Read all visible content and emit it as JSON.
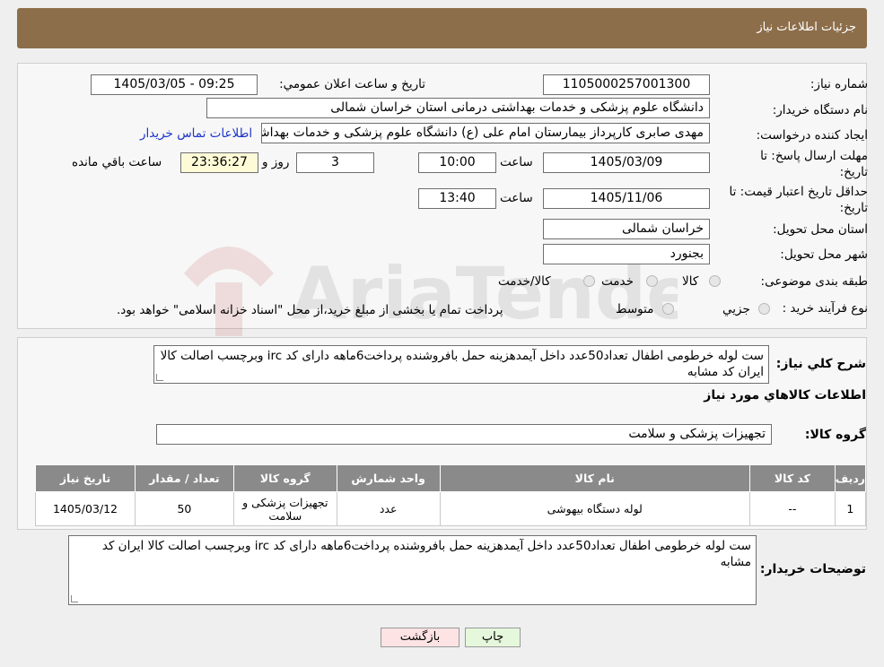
{
  "header": {
    "title": "جزئیات اطلاعات نیاز"
  },
  "watermark": {
    "text": "AriaTender.neT"
  },
  "form": {
    "need_number_label": "شماره نیاز:",
    "need_number": "1105000257001300",
    "announce_label": "تاریخ و ساعت اعلان عمومي:",
    "announce_value": "1405/03/05 - 09:25",
    "buyer_org_label": "نام دستگاه خريدار:",
    "buyer_org": "دانشگاه علوم پزشکی و خدمات بهداشتی درمانی استان خراسان شمالی",
    "creator_label": "ايجاد کننده درخواست:",
    "creator": "مهدی صابری کارپرداز بیمارستان امام علی (ع) دانشگاه علوم پزشکی و خدمات بهداشتی",
    "contact_link": "اطلاعات تماس خريدار",
    "deadline_label_1": "مهلت ارسال پاسخ: تا",
    "deadline_label_2": "تاريخ:",
    "deadline_date": "1405/03/09",
    "time_label": "ساعت",
    "deadline_time": "10:00",
    "days_value": "3",
    "days_label": "روز و",
    "remaining_time": "23:36:27",
    "remaining_label": "ساعت باقي مانده",
    "validity_label_1": "حداقل تاريخ اعتبار قيمت: تا",
    "validity_label_2": "تاريخ:",
    "validity_date": "1405/11/06",
    "validity_time": "13:40",
    "province_label": "استان محل تحويل:",
    "province": "خراسان شمالی",
    "city_label": "شهر محل تحويل:",
    "city": "بجنورد",
    "category_label": "طبقه بندی موضوعی:",
    "category_options": [
      "کالا",
      "خدمت",
      "کالا/خدمت"
    ],
    "process_label": "نوع فرآيند خريد :",
    "process_options": [
      "جزيي",
      "متوسط"
    ],
    "process_note": "پرداخت تمام يا بخشی از مبلغ خريد،از محل \"اسناد خزانه اسلامی\" خواهد بود."
  },
  "summary": {
    "label": "شرح کلي نياز:",
    "text": "ست لوله خرطومی اطفال  تعداد50عدد داخل آیمدهزینه حمل بافروشنده پرداخت6ماهه دارای کد irc وبرچسب اصالت کالا ایران کد مشابه",
    "items_title": "اطلاعات کالاهاي مورد نياز",
    "group_label": "گروه کالا:",
    "group_value": "تجهیزات پزشکی و سلامت"
  },
  "table": {
    "headers": [
      "رديف",
      "کد کالا",
      "نام کالا",
      "واحد شمارش",
      "گروه کالا",
      "تعداد / مقدار",
      "تاريخ نياز"
    ],
    "rows": [
      [
        "1",
        "--",
        "لوله دستگاه بیهوشی",
        "عدد",
        "تجهیزات پزشکی و سلامت",
        "50",
        "1405/03/12"
      ]
    ]
  },
  "buyer_notes": {
    "label": "توضيحات خريدار:",
    "text": "ست لوله خرطومی اطفال تعداد50عدد داخل آیمدهزینه حمل بافروشنده پرداخت6ماهه دارای کد irc وبرچسب اصالت کالا ایران کد مشابه"
  },
  "buttons": {
    "print": "چاپ",
    "back": "بازگشت"
  },
  "colors": {
    "header_bg": "#8d6e4a",
    "link": "#1a33cc",
    "back_btn": "#fde3e3",
    "print_btn": "#e6f8dc"
  }
}
